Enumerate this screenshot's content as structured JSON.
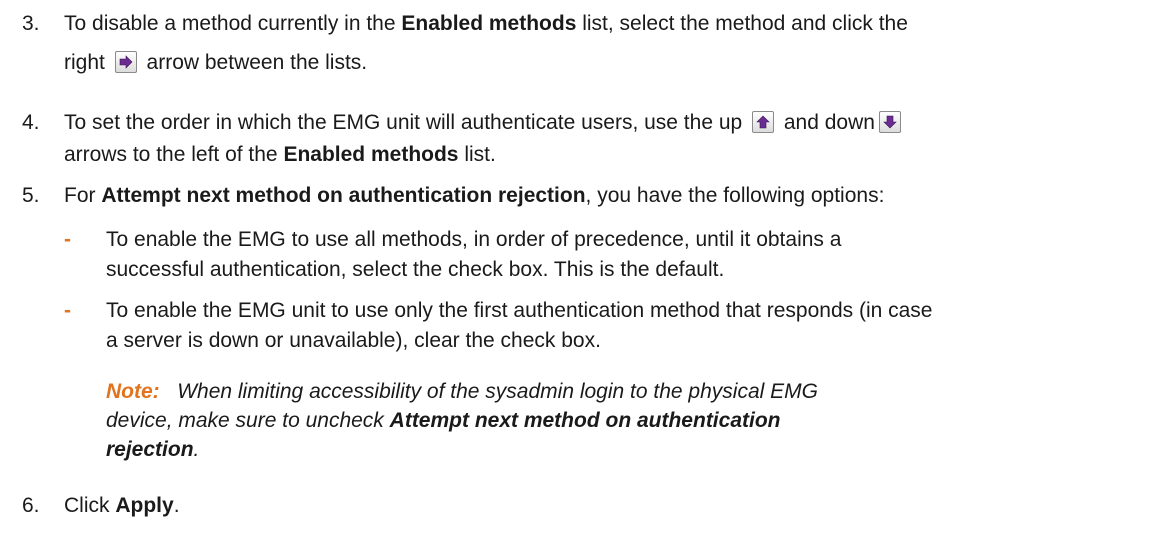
{
  "steps": [
    {
      "number": "3.",
      "line1": [
        "To disable a method currently in the ",
        "Enabled methods",
        " list, select the method and click the"
      ],
      "line2": [
        "right ",
        "arrow between the lists."
      ],
      "icon": "right-arrow-icon"
    },
    {
      "number": "4.",
      "line1": [
        "To set the order in which the EMG unit will authenticate users, use the up ",
        "and down"
      ],
      "line2": [
        "arrows to the left of the ",
        "Enabled methods",
        " list."
      ],
      "icons": [
        "up-arrow-icon",
        "down-arrow-icon"
      ]
    },
    {
      "number": "5.",
      "line1": [
        "For ",
        "Attempt next method on authentication rejection",
        ", you have the following options:"
      ]
    },
    {
      "number": "6.",
      "line1": [
        "Click ",
        "Apply",
        "."
      ]
    }
  ],
  "bullets": [
    {
      "dash": "-",
      "lines": [
        "To enable the EMG to use all methods, in order of precedence, until it obtains a",
        "successful authentication, select the check box. This is the default."
      ]
    },
    {
      "dash": "-",
      "lines": [
        "To enable the EMG unit to use only the first authentication method that responds (in case",
        "a server is down or unavailable), clear the check box."
      ]
    }
  ],
  "note": {
    "label": "Note:",
    "line1": "When limiting accessibility of the sysadmin login to the physical EMG",
    "line2": [
      "device, make sure to uncheck ",
      "Attempt next method on authentication"
    ],
    "line3": [
      "rejection",
      "."
    ]
  },
  "colors": {
    "accent": "#e2731f",
    "icon_arrow": "#6a2c91"
  }
}
